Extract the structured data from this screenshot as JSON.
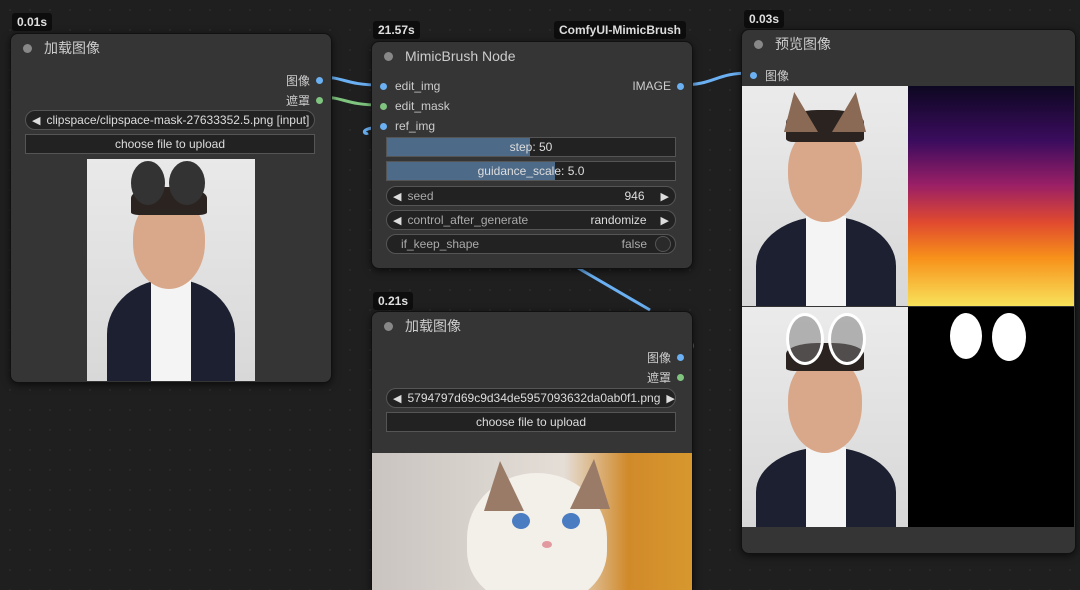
{
  "load_image_1": {
    "timing": "0.01s",
    "title": "加载图像",
    "output_image": "图像",
    "output_mask": "遮罩",
    "file_value": "clipspace/clipspace-mask-27633352.5.png [input]",
    "upload_label": "choose file to upload"
  },
  "mimic": {
    "timing": "21.57s",
    "badge": "ComfyUI-MimicBrush",
    "title": "MimicBrush Node",
    "inputs": [
      "edit_img",
      "edit_mask",
      "ref_img"
    ],
    "output": "IMAGE",
    "step_label": "step: 50",
    "step_value": 50,
    "guidance_label": "guidance_scale: 5.0",
    "seed_label": "seed",
    "seed_value": "946",
    "cag_label": "control_after_generate",
    "cag_value": "randomize",
    "keep_label": "if_keep_shape",
    "keep_value": "false"
  },
  "load_image_2": {
    "timing": "0.21s",
    "title": "加载图像",
    "output_image": "图像",
    "output_mask": "遮罩",
    "file_value": "5794797d69c9d34de5957093632da0ab0f1.png",
    "upload_label": "choose file to upload"
  },
  "preview": {
    "timing": "0.03s",
    "title": "预览图像",
    "input_image": "图像"
  },
  "colors": {
    "node_bg": "#353535",
    "link_blue": "#6ab0f3",
    "link_green": "#7fc47f",
    "slider_fill": "#4d6a88"
  }
}
